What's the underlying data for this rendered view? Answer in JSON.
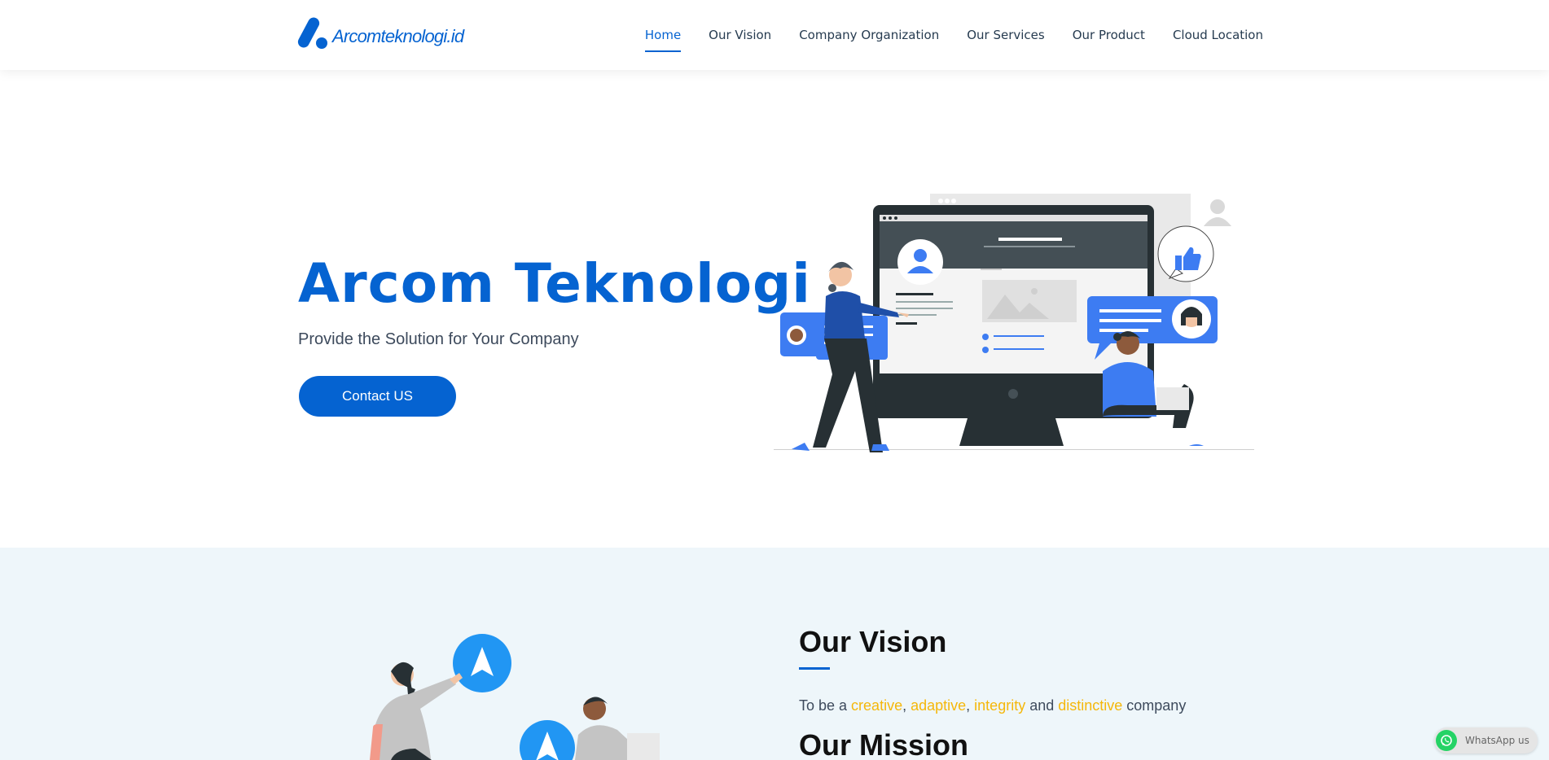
{
  "header": {
    "logo_text": "Arcomteknologi.id",
    "nav": [
      {
        "label": "Home",
        "active": true
      },
      {
        "label": "Our Vision",
        "active": false
      },
      {
        "label": "Company Organization",
        "active": false
      },
      {
        "label": "Our Services",
        "active": false
      },
      {
        "label": "Our Product",
        "active": false
      },
      {
        "label": "Cloud Location",
        "active": false
      }
    ]
  },
  "hero": {
    "title": "Arcom Teknologi",
    "subtitle": "Provide the Solution for Your Company",
    "cta_label": "Contact US"
  },
  "vision": {
    "title": "Our Vision",
    "text_parts": [
      "To be a ",
      "creative",
      ", ",
      "adaptive",
      ", ",
      "integrity",
      " and ",
      "distinctive",
      " company"
    ],
    "mission_title": "Our Mission"
  },
  "whatsapp": {
    "label": "WhatsApp us"
  },
  "colors": {
    "brand": "#0563d1",
    "highlight": "#f5b70a",
    "section_bg": "#eef6fa",
    "whatsapp": "#25d366"
  }
}
